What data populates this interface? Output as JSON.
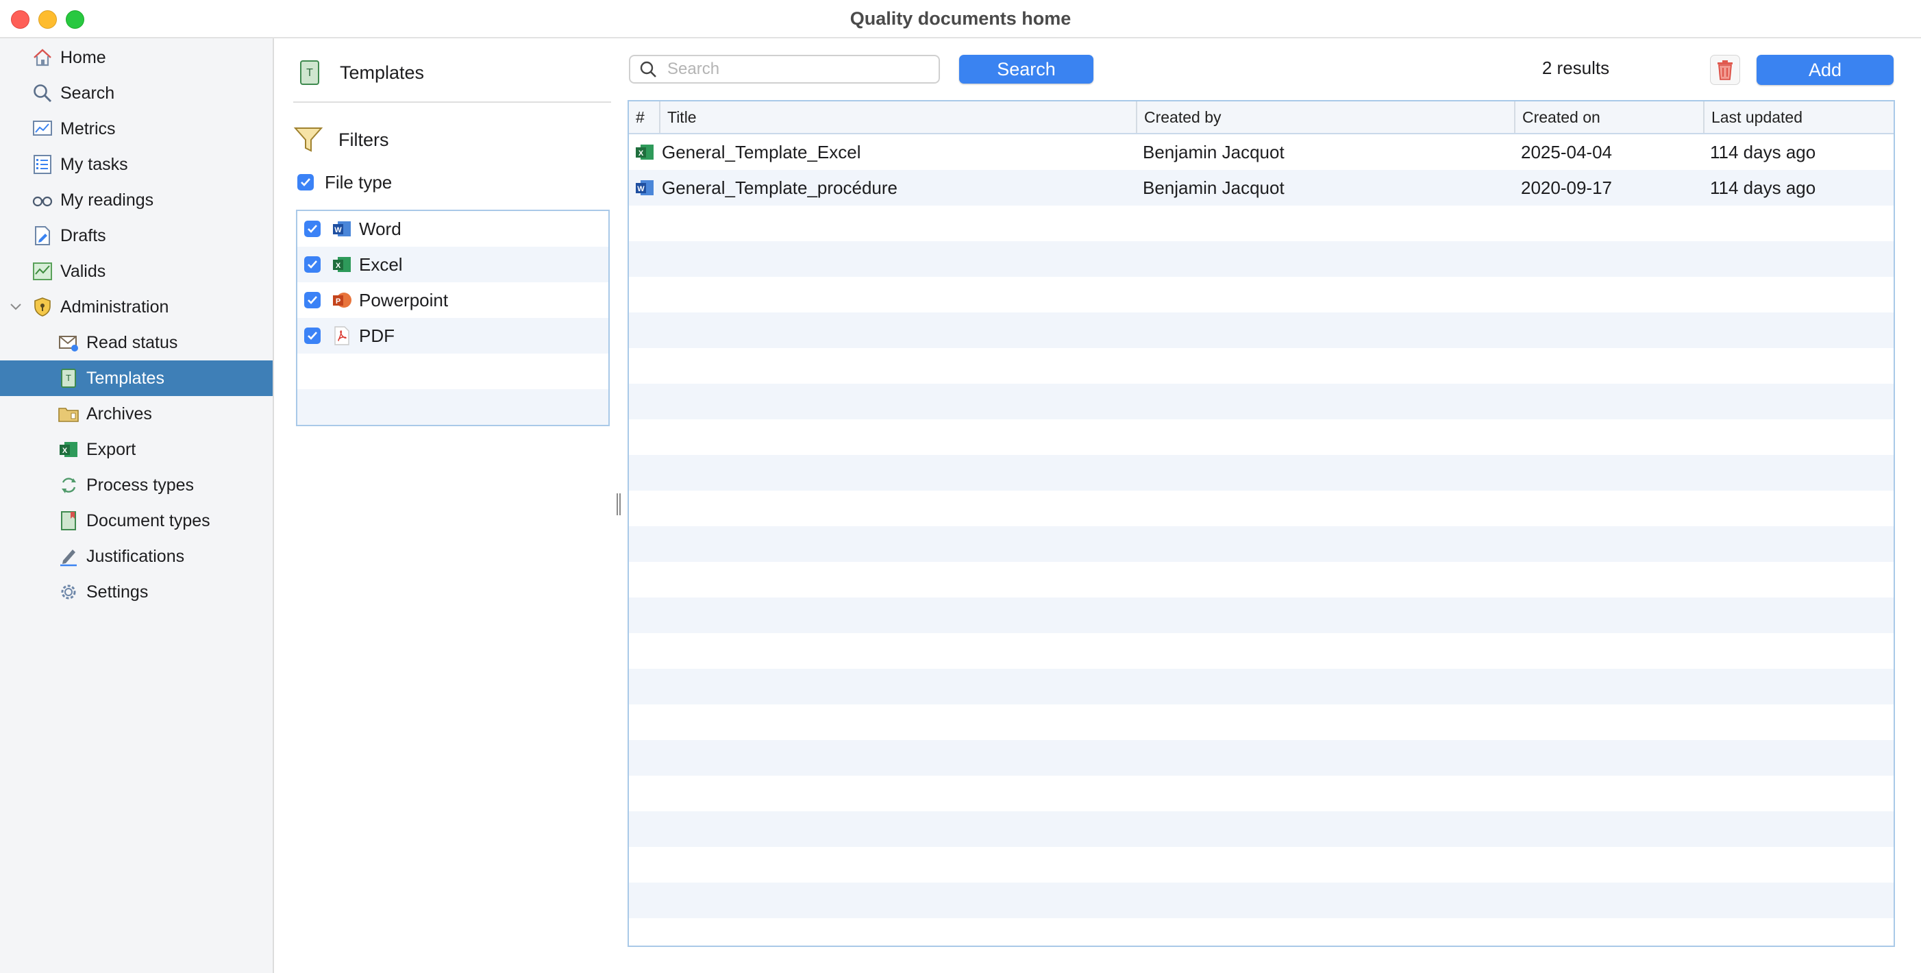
{
  "window": {
    "title": "Quality documents home"
  },
  "sidebar": {
    "items": [
      {
        "label": "Home",
        "icon": "house-icon"
      },
      {
        "label": "Search",
        "icon": "search-icon"
      },
      {
        "label": "Metrics",
        "icon": "chart-icon"
      },
      {
        "label": "My tasks",
        "icon": "checklist-icon"
      },
      {
        "label": "My readings",
        "icon": "glasses-icon"
      },
      {
        "label": "Drafts",
        "icon": "draft-document-icon"
      },
      {
        "label": "Valids",
        "icon": "valid-chart-icon"
      },
      {
        "label": "Administration",
        "icon": "shield-icon"
      },
      {
        "label": "Read status",
        "icon": "mail-status-icon"
      },
      {
        "label": "Templates",
        "icon": "template-book-icon"
      },
      {
        "label": "Archives",
        "icon": "archive-folder-icon"
      },
      {
        "label": "Export",
        "icon": "excel-export-icon"
      },
      {
        "label": "Process types",
        "icon": "recycle-icon"
      },
      {
        "label": "Document types",
        "icon": "document-bookmark-icon"
      },
      {
        "label": "Justifications",
        "icon": "pencil-icon"
      },
      {
        "label": "Settings",
        "icon": "gear-icon"
      }
    ],
    "active": "Templates"
  },
  "filters_panel": {
    "header": "Templates",
    "filters_title": "Filters",
    "file_type_label": "File type",
    "file_types": [
      {
        "label": "Word",
        "checked": true,
        "icon": "word-icon"
      },
      {
        "label": "Excel",
        "checked": true,
        "icon": "excel-icon"
      },
      {
        "label": "Powerpoint",
        "checked": true,
        "icon": "powerpoint-icon"
      },
      {
        "label": "PDF",
        "checked": true,
        "icon": "pdf-icon"
      }
    ]
  },
  "toolbar": {
    "search_placeholder": "Search",
    "search_value": "",
    "search_button": "Search",
    "results": "2 results",
    "add_button": "Add"
  },
  "table": {
    "columns": [
      "#",
      "Title",
      "Created by",
      "Created on",
      "Last updated"
    ],
    "rows": [
      {
        "icon": "excel-icon",
        "title": "General_Template_Excel",
        "created_by": "Benjamin Jacquot",
        "created_on": "2025-04-04",
        "last_updated": "114 days ago"
      },
      {
        "icon": "word-icon",
        "title": "General_Template_procédure",
        "created_by": "Benjamin Jacquot",
        "created_on": "2020-09-17",
        "last_updated": "114 days ago"
      }
    ]
  },
  "colors": {
    "accent": "#3a83f1",
    "sidebar_active": "#3e7fb7",
    "stripe": "#f1f5fb",
    "border": "#a9c9e8"
  }
}
